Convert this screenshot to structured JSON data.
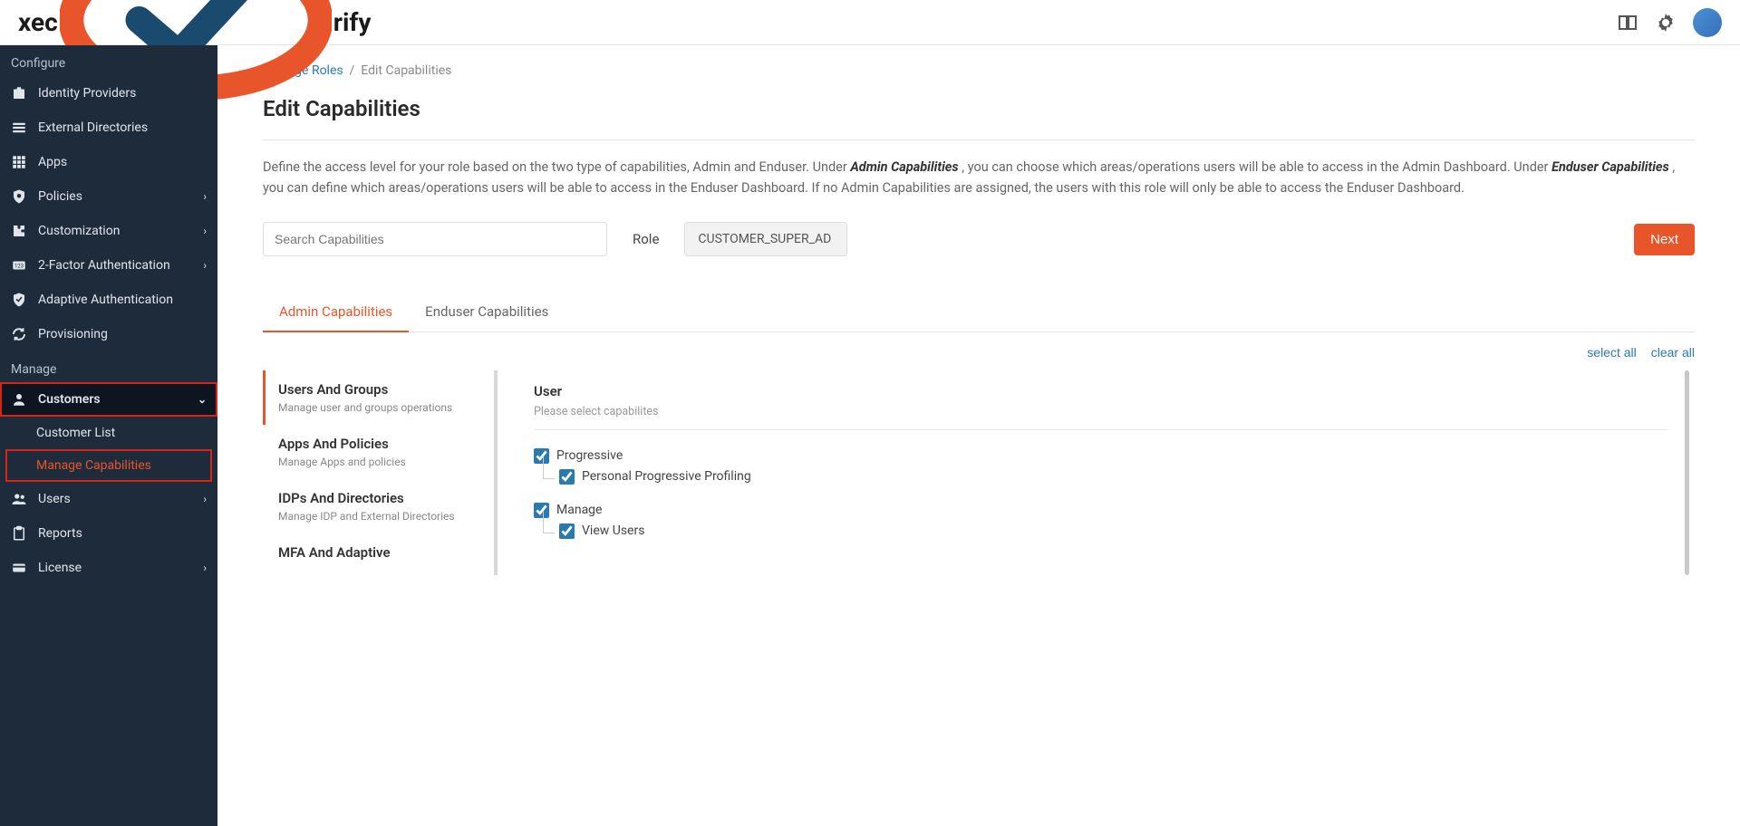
{
  "logo": {
    "pre": "xec",
    "post": "rify"
  },
  "sidebar": {
    "configure_label": "Configure",
    "manage_label": "Manage",
    "configure_items": [
      {
        "label": "Identity Providers",
        "icon": "badge-icon"
      },
      {
        "label": "External Directories",
        "icon": "list-icon"
      },
      {
        "label": "Apps",
        "icon": "grid-icon"
      },
      {
        "label": "Policies",
        "icon": "shield-icon",
        "expandable": true
      },
      {
        "label": "Customization",
        "icon": "puzzle-icon",
        "expandable": true
      },
      {
        "label": "2-Factor Authentication",
        "icon": "num-icon",
        "expandable": true
      },
      {
        "label": "Adaptive Authentication",
        "icon": "shield-check-icon"
      },
      {
        "label": "Provisioning",
        "icon": "sync-icon"
      }
    ],
    "manage_items": [
      {
        "label": "Customers",
        "icon": "person-icon",
        "expandable": true,
        "expanded": true,
        "highlighted": true,
        "subitems": [
          {
            "label": "Customer List"
          },
          {
            "label": "Manage Capabilities",
            "active": true
          }
        ]
      },
      {
        "label": "Users",
        "icon": "people-icon",
        "expandable": true
      },
      {
        "label": "Reports",
        "icon": "clipboard-icon"
      },
      {
        "label": "License",
        "icon": "card-icon",
        "expandable": true
      }
    ]
  },
  "breadcrumb": {
    "parent": "Manage Roles",
    "current": "Edit Capabilities"
  },
  "page": {
    "title": "Edit Capabilities",
    "desc_pre": "Define the access level for your role based on the two type of capabilities, Admin and Enduser. Under ",
    "desc_admin": "Admin Capabilities",
    "desc_mid": ", you can choose which areas/operations users will be able to access in the Admin Dashboard. Under ",
    "desc_enduser": "Enduser Capabilities",
    "desc_post": ", you can define which areas/operations users will be able to access in the Enduser Dashboard. If no Admin Capabilities are assigned, the users with this role will only be able to access the Enduser Dashboard."
  },
  "controls": {
    "search_placeholder": "Search Capabilities",
    "role_label": "Role",
    "role_value": "CUSTOMER_SUPER_AD",
    "next_label": "Next"
  },
  "tabs": [
    {
      "label": "Admin Capabilities",
      "active": true
    },
    {
      "label": "Enduser Capabilities"
    }
  ],
  "bulk": {
    "select_all": "select all",
    "clear_all": "clear all"
  },
  "categories": [
    {
      "title": "Users And Groups",
      "desc": "Manage user and groups operations",
      "active": true
    },
    {
      "title": "Apps And Policies",
      "desc": "Manage Apps and policies"
    },
    {
      "title": "IDPs And Directories",
      "desc": "Manage IDP and External Directories"
    },
    {
      "title": "MFA And Adaptive",
      "desc": ""
    }
  ],
  "detail": {
    "title": "User",
    "subtitle": "Please select capabilites",
    "groups": [
      {
        "label": "Progressive",
        "checked": true,
        "children": [
          {
            "label": "Personal Progressive Profiling",
            "checked": true
          }
        ]
      },
      {
        "label": "Manage",
        "checked": true,
        "children": [
          {
            "label": "View Users",
            "checked": true
          }
        ]
      }
    ]
  }
}
